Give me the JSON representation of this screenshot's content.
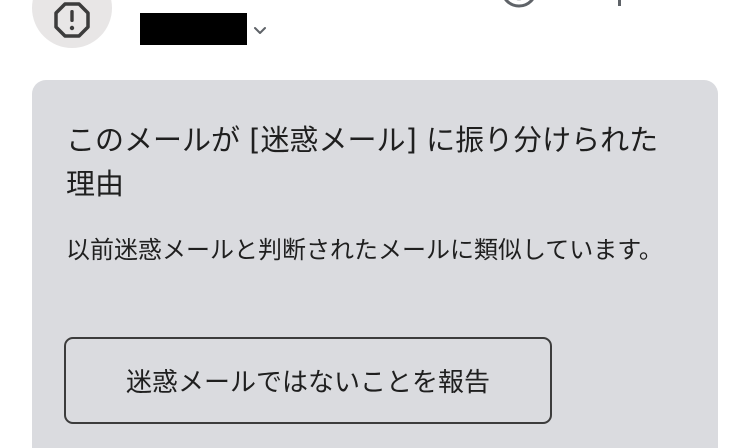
{
  "header": {
    "avatar_icon": "alert-octagon-icon",
    "expand_icon": "chevron-down-icon"
  },
  "spam_notice": {
    "title": "このメールが [迷惑メール] に振り分けられた理由",
    "body": "以前迷惑メールと判断されたメールに類似しています。",
    "report_button_label": "迷惑メールではないことを報告"
  },
  "colors": {
    "card_background": "#dadbdf",
    "avatar_background": "#e8e6e6",
    "text": "#1f1f1f",
    "button_border": "#3c3c3c"
  }
}
